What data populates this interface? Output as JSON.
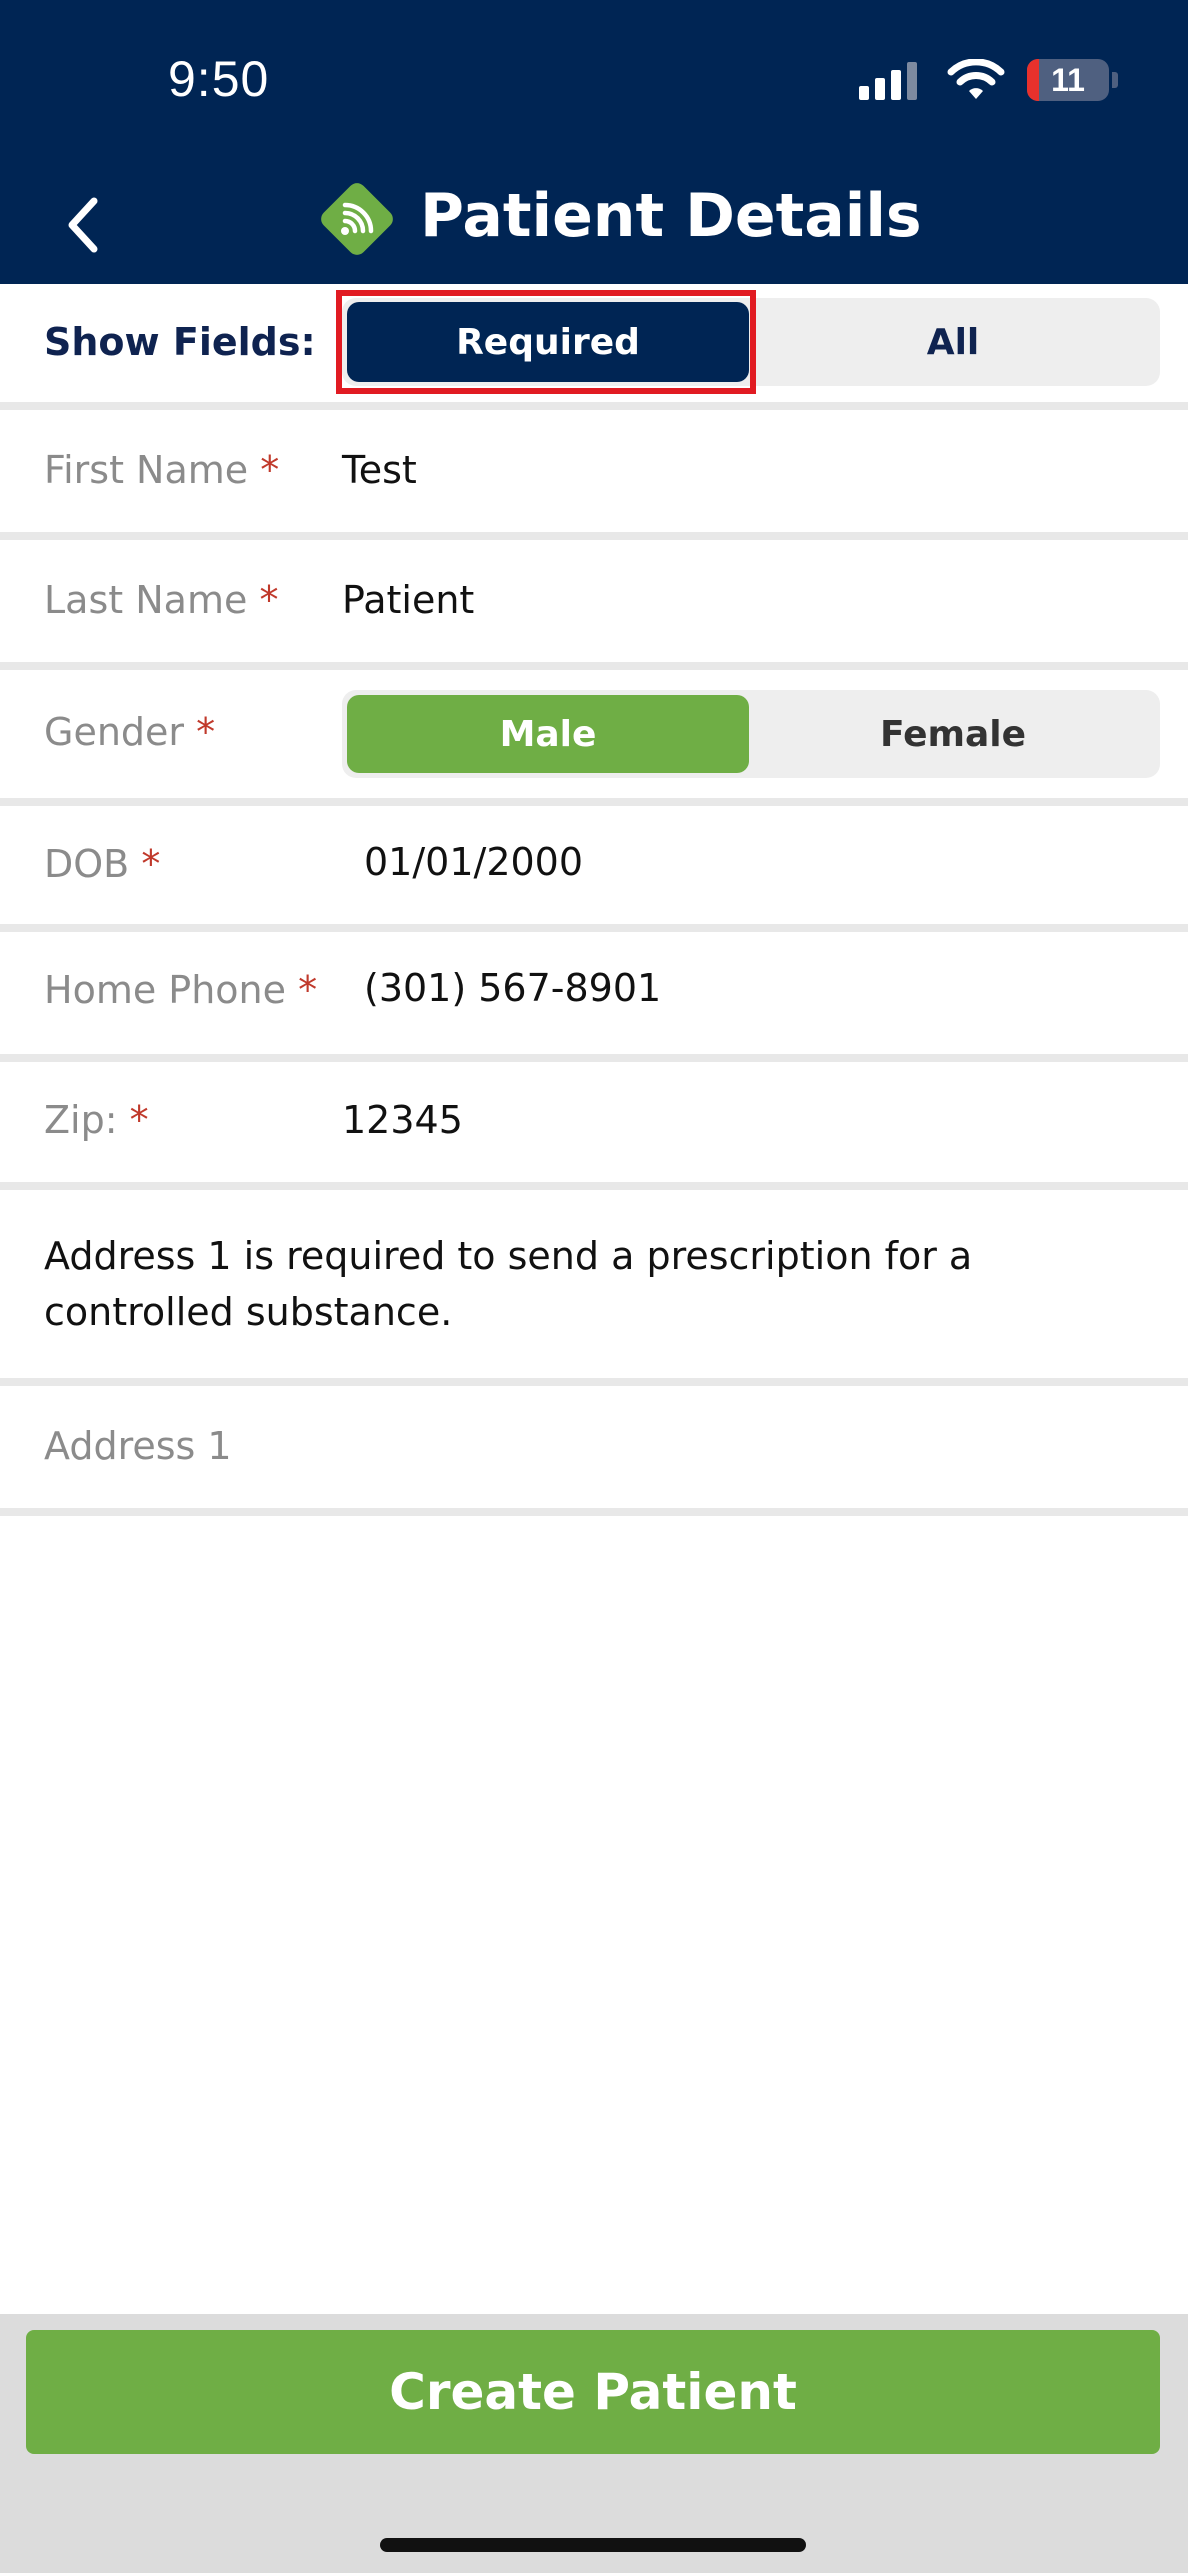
{
  "status_bar": {
    "time": "9:50",
    "battery": "11"
  },
  "header": {
    "title": "Patient Details"
  },
  "show_fields": {
    "label": "Show Fields:",
    "options": [
      "Required",
      "All"
    ],
    "selected": "Required"
  },
  "fields": {
    "first_name": {
      "label": "First Name",
      "required_mark": "*",
      "value": "Test"
    },
    "last_name": {
      "label": "Last Name",
      "required_mark": "*",
      "value": "Patient"
    },
    "gender": {
      "label": "Gender",
      "required_mark": "*",
      "options": [
        "Male",
        "Female"
      ],
      "selected": "Male"
    },
    "dob": {
      "label": "DOB",
      "required_mark": "*",
      "value": "01/01/2000"
    },
    "home_phone": {
      "label": "Home Phone",
      "required_mark": "*",
      "value": "(301) 567-8901"
    },
    "zip": {
      "label": "Zip:",
      "required_mark": "*",
      "value": "12345"
    },
    "address1": {
      "placeholder": "Address 1"
    }
  },
  "notice": "Address 1 is required to send a prescription for a controlled substance.",
  "footer": {
    "create_label": "Create Patient"
  },
  "colors": {
    "header_bg": "#002554",
    "accent_green": "#6fae45",
    "required_red": "#c0392b",
    "highlight_red": "#e11b22"
  }
}
